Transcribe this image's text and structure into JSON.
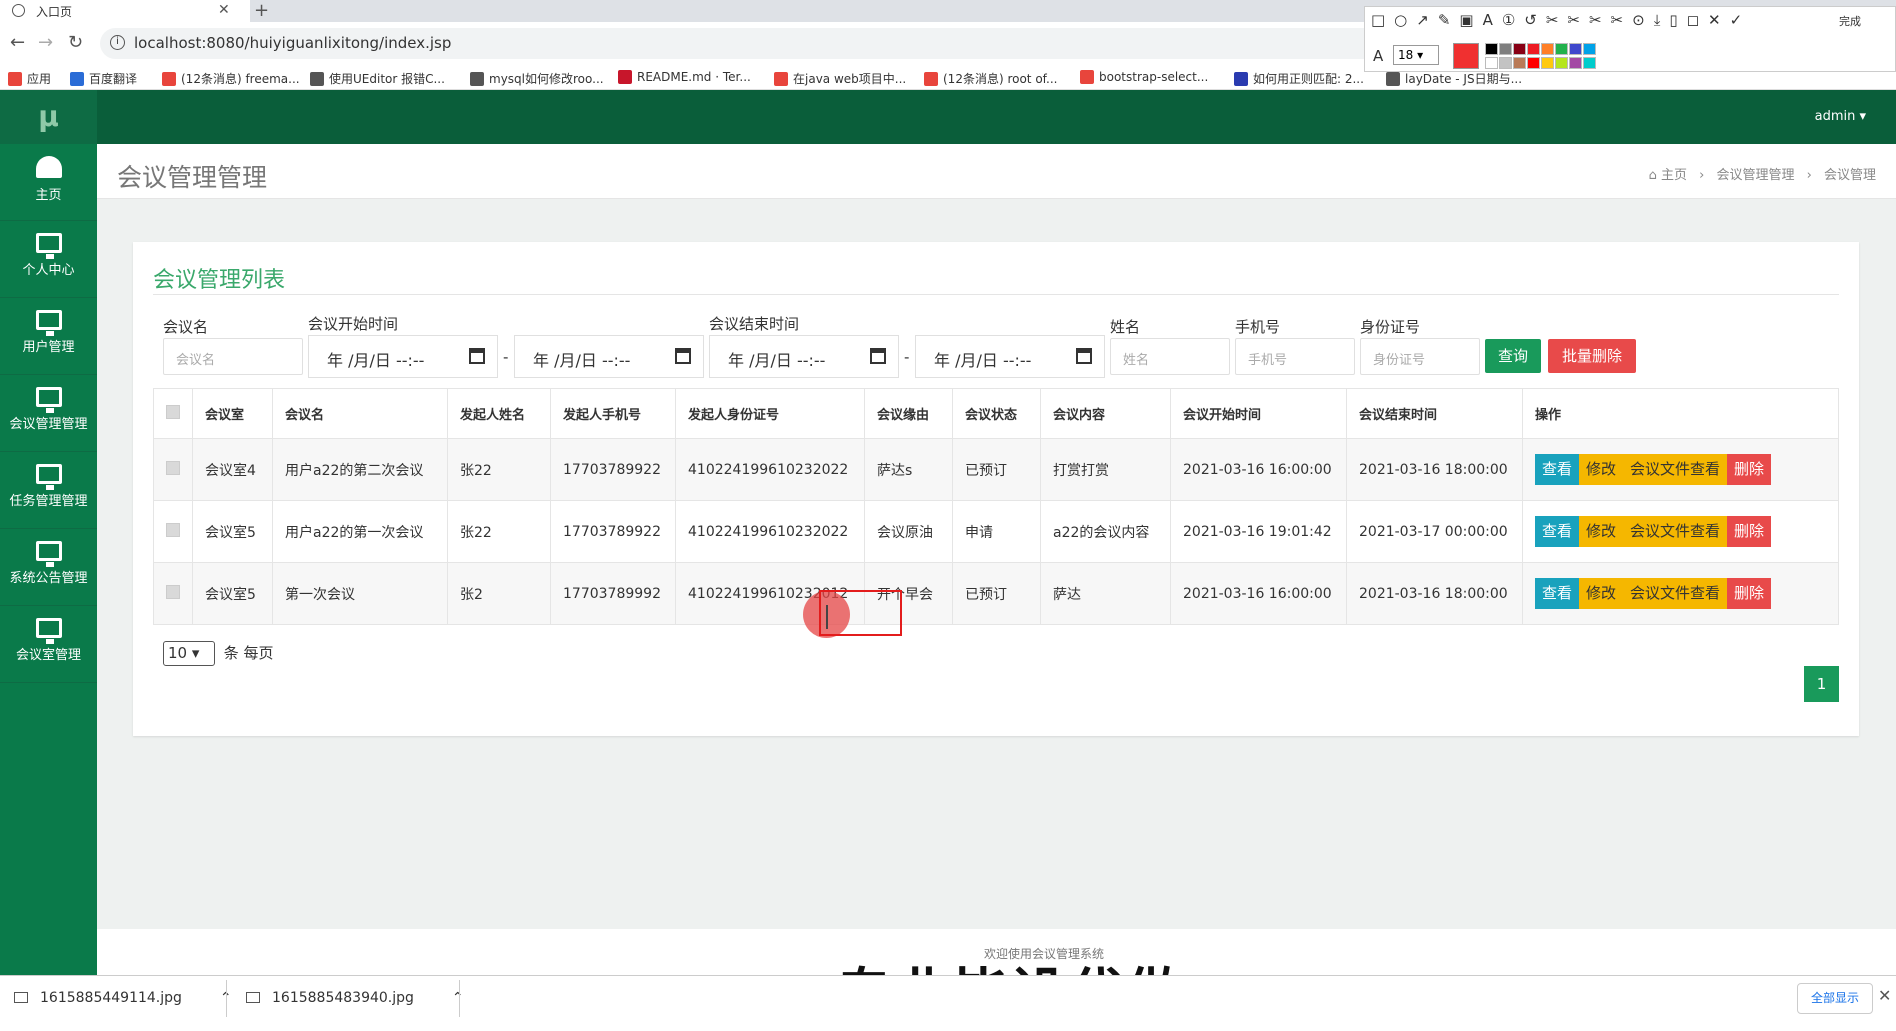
{
  "browser": {
    "tab_title": "入口页",
    "url": "localhost:8080/huiyiguanlixitong/index.jsp",
    "bookmarks": [
      {
        "label": "应用",
        "color": "#e8453c"
      },
      {
        "label": "百度翻译",
        "color": "#2a6cd6"
      },
      {
        "label": "(12条消息) freema...",
        "color": "#e8453c"
      },
      {
        "label": "使用UEditor 报错C...",
        "color": "#555555"
      },
      {
        "label": "mysql如何修改roo...",
        "color": "#555555"
      },
      {
        "label": "README.md · Ter...",
        "color": "#c7162b"
      },
      {
        "label": "在java web项目中...",
        "color": "#e8453c"
      },
      {
        "label": "(12条消息) root of...",
        "color": "#e8453c"
      },
      {
        "label": "bootstrap-select...",
        "color": "#e8453c"
      },
      {
        "label": "如何用正则匹配: 2...",
        "color": "#2a3bb0"
      },
      {
        "label": "layDate - JS日期与...",
        "color": "#555555"
      }
    ]
  },
  "annotation_toolbar": {
    "tools": "□○↗✎▣A①↺✂✂✂✂⊙⤓▯◻✕✓",
    "done_label": "完成",
    "font_size": "18",
    "current_color": "#f03030",
    "palette": [
      "#000000",
      "#7f7f7f",
      "#880015",
      "#ed1c24",
      "#ff7f27",
      "#22b14c",
      "#3f48cc",
      "#00a2e8",
      "#ffffff",
      "#c3c3c3",
      "#b97a57",
      "#ff0000",
      "#ffc90e",
      "#b5e61d",
      "#a349a4",
      "#00cccc"
    ]
  },
  "sidebar": {
    "logo": "μ",
    "items": [
      {
        "label": "主页",
        "icon": "dashboard-icon"
      },
      {
        "label": "个人中心",
        "icon": "monitor-icon"
      },
      {
        "label": "用户管理",
        "icon": "monitor-icon"
      },
      {
        "label": "会议管理管理",
        "icon": "monitor-icon"
      },
      {
        "label": "任务管理管理",
        "icon": "monitor-icon"
      },
      {
        "label": "系统公告管理",
        "icon": "monitor-icon"
      },
      {
        "label": "会议室管理",
        "icon": "monitor-icon"
      }
    ]
  },
  "topbar": {
    "user": "admin ▾"
  },
  "header": {
    "title": "会议管理管理",
    "breadcrumb": [
      "主页",
      "会议管理管理",
      "会议管理"
    ]
  },
  "panel": {
    "title": "会议管理列表",
    "filters": {
      "name_label": "会议名",
      "name_placeholder": "会议名",
      "start_label": "会议开始时间",
      "end_label": "会议结束时间",
      "date_placeholder": "年 /月/日 --:--",
      "dash": "-",
      "person_label": "姓名",
      "person_placeholder": "姓名",
      "phone_label": "手机号",
      "phone_placeholder": "手机号",
      "id_label": "身份证号",
      "id_placeholder": "身份证号",
      "query_button": "查询",
      "batch_delete_button": "批量删除"
    },
    "table": {
      "headers": [
        "会议室",
        "会议名",
        "发起人姓名",
        "发起人手机号",
        "发起人身份证号",
        "会议缘由",
        "会议状态",
        "会议内容",
        "会议开始时间",
        "会议结束时间",
        "操作"
      ],
      "rows": [
        [
          "会议室4",
          "用户a22的第二次会议",
          "张22",
          "17703789922",
          "410224199610232022",
          "萨达s",
          "已预订",
          "打赏打赏",
          "2021-03-16 16:00:00",
          "2021-03-16 18:00:00"
        ],
        [
          "会议室5",
          "用户a22的第一次会议",
          "张22",
          "17703789922",
          "410224199610232022",
          "会议原油",
          "申请",
          "a22的会议内容",
          "2021-03-16 19:01:42",
          "2021-03-17 00:00:00"
        ],
        [
          "会议室5",
          "第一次会议",
          "张2",
          "17703789992",
          "410224199610232012",
          "开个早会",
          "已预订",
          "萨达",
          "2021-03-16 16:00:00",
          "2021-03-16 18:00:00"
        ]
      ],
      "actions": {
        "view": "查看",
        "edit": "修改",
        "files": "会议文件查看",
        "delete": "删除"
      }
    },
    "page_size": "10",
    "page_size_suffix": "条 每页",
    "current_page": "1"
  },
  "footer": {
    "text": "欢迎使用会议管理系统"
  },
  "overlay": {
    "watermark": "专业毕设代做"
  },
  "downloads": {
    "files": [
      "1615885449114.jpg",
      "1615885483940.jpg"
    ],
    "show_all": "全部显示"
  },
  "colors": {
    "sidebar": "#0a7a4a",
    "topbar": "#0a5e3a",
    "accent_green": "#199a5b",
    "danger": "#e84a4a",
    "info": "#19a2bd",
    "warning": "#f5b700"
  }
}
